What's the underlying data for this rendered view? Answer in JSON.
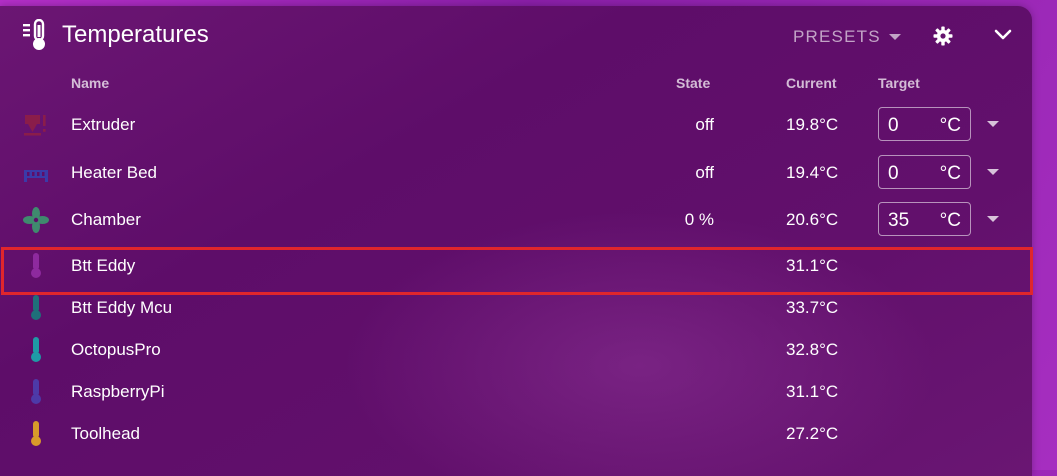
{
  "header": {
    "title": "Temperatures",
    "presets_label": "PRESETS"
  },
  "columns": {
    "name": "Name",
    "state": "State",
    "current": "Current",
    "target": "Target"
  },
  "rows": [
    {
      "name": "Extruder",
      "state": "off",
      "current": "19.8°C",
      "target": "0",
      "unit": "°C",
      "icon": "extruder-icon",
      "color": "#8a1d4a"
    },
    {
      "name": "Heater Bed",
      "state": "off",
      "current": "19.4°C",
      "target": "0",
      "unit": "°C",
      "icon": "heater-bed-icon",
      "color": "#3b3aa8"
    },
    {
      "name": "Chamber",
      "state": "0 %",
      "current": "20.6°C",
      "target": "35",
      "unit": "°C",
      "icon": "fan-icon",
      "color": "#3f8a6e"
    },
    {
      "name": "Btt Eddy",
      "state": "",
      "current": "31.1°C",
      "icon": "thermometer-icon",
      "color": "#8e2a9e"
    },
    {
      "name": "Btt Eddy Mcu",
      "state": "",
      "current": "33.7°C",
      "icon": "thermometer-icon",
      "color": "#1f6f7a"
    },
    {
      "name": "OctopusPro",
      "state": "",
      "current": "32.8°C",
      "icon": "thermometer-icon",
      "color": "#1f9aa6"
    },
    {
      "name": "RaspberryPi",
      "state": "",
      "current": "31.1°C",
      "icon": "thermometer-icon",
      "color": "#4d3aa8"
    },
    {
      "name": "Toolhead",
      "state": "",
      "current": "27.2°C",
      "icon": "thermometer-icon",
      "color": "#d89a2a"
    }
  ],
  "highlight_color": "#e0262c"
}
